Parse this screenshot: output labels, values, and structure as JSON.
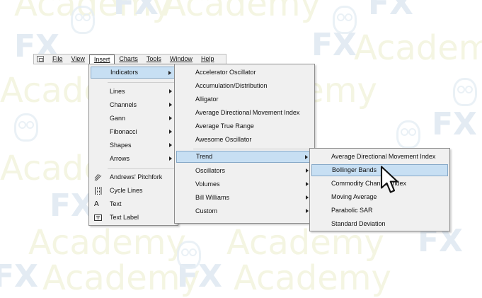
{
  "watermark": {
    "fx": "FX",
    "academy": "Academy"
  },
  "menubar": {
    "items": [
      "File",
      "View",
      "Insert",
      "Charts",
      "Tools",
      "Window",
      "Help"
    ],
    "active": "Insert"
  },
  "insert_menu": {
    "indicators": "Indicators",
    "lines": "Lines",
    "channels": "Channels",
    "gann": "Gann",
    "fibonacci": "Fibonacci",
    "shapes": "Shapes",
    "arrows": "Arrows",
    "andrews_pitchfork": "Andrews' Pitchfork",
    "cycle_lines": "Cycle Lines",
    "text": "Text",
    "text_label": "Text Label",
    "text_icon": "A"
  },
  "indicators_menu": {
    "items": [
      "Accelerator Oscillator",
      "Accumulation/Distribution",
      "Alligator",
      "Average Directional Movement Index",
      "Average True Range",
      "Awesome Oscillator"
    ],
    "trend": "Trend",
    "oscillators": "Oscillators",
    "volumes": "Volumes",
    "bill_williams": "Bill Williams",
    "custom": "Custom"
  },
  "trend_menu": {
    "items": [
      "Average Directional Movement Index",
      "Bollinger Bands",
      "Commodity Channel Index",
      "Moving Average",
      "Parabolic SAR",
      "Standard Deviation"
    ],
    "highlighted": "Bollinger Bands"
  },
  "colors": {
    "highlight": "#c7dff3",
    "menu_bg": "#f0f0f0",
    "watermark_fx": "#e3ebf3"
  }
}
